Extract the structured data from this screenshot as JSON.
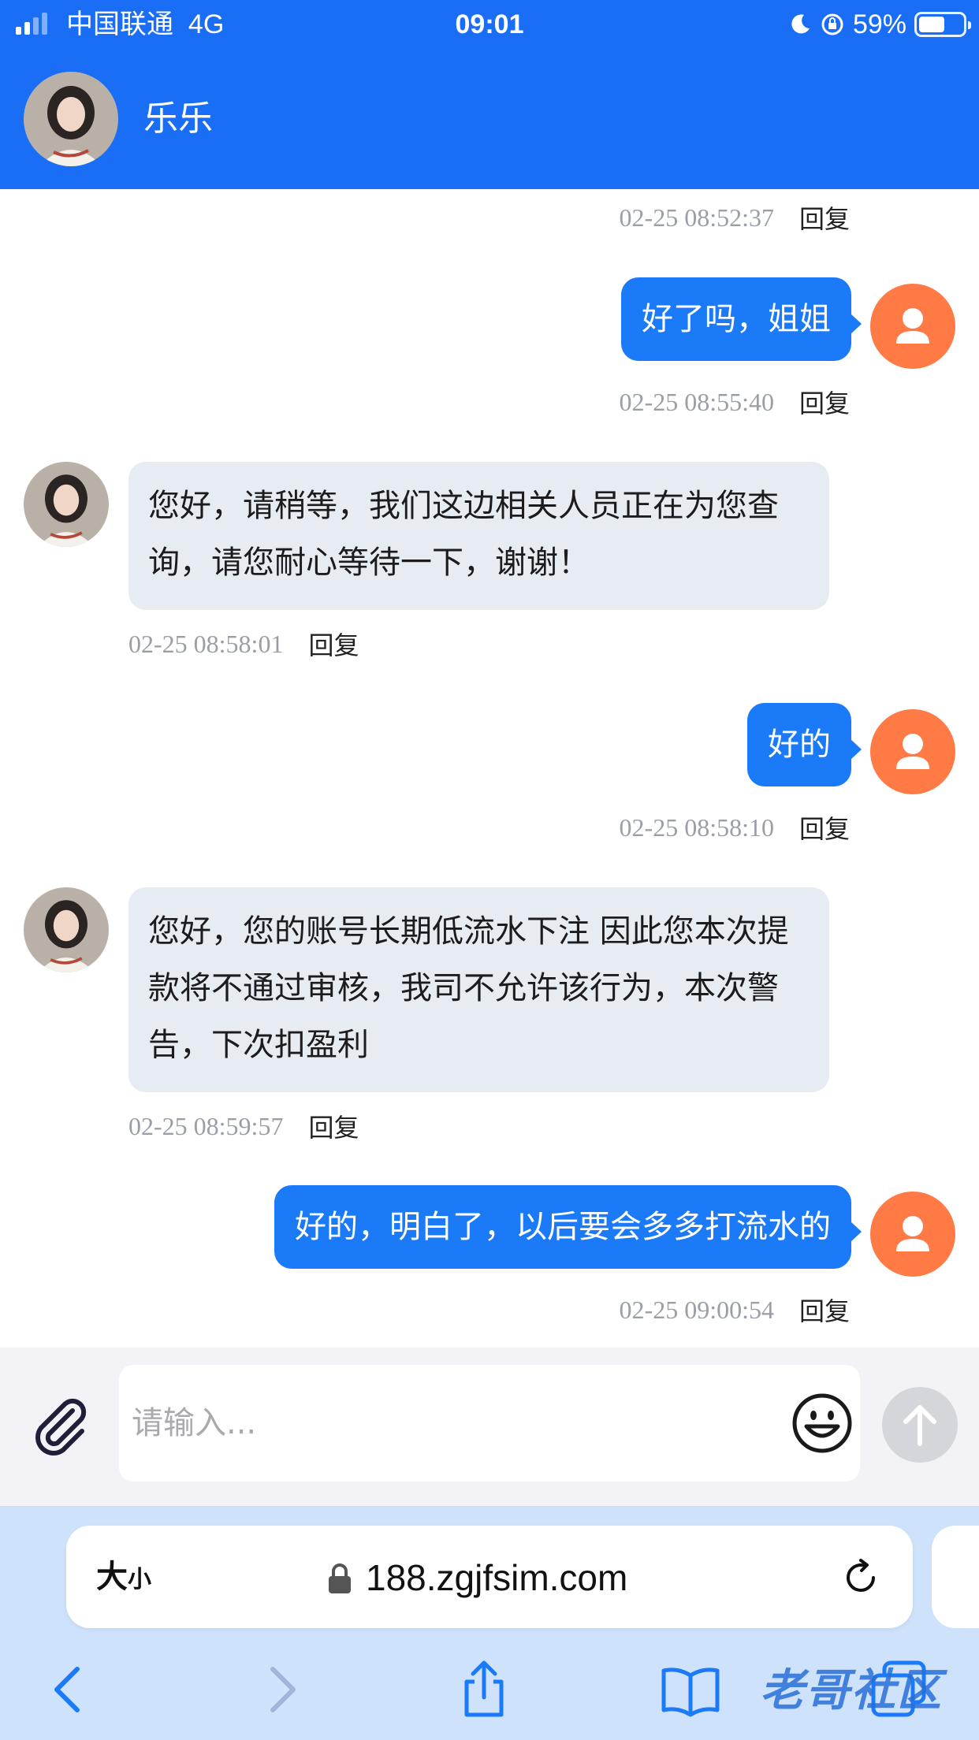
{
  "status_bar": {
    "carrier": "中国联通",
    "network": "4G",
    "time": "09:01",
    "battery_percent": "59%",
    "battery_level": 0.59
  },
  "header": {
    "contact_name": "乐乐"
  },
  "messages": [
    {
      "timestamp": "02-25 08:52:37",
      "reply": "回复"
    },
    {
      "text": "好了吗，姐姐",
      "timestamp": "02-25 08:55:40",
      "reply": "回复"
    },
    {
      "text": "您好，请稍等，我们这边相关人员正在为您查询，请您耐心等待一下，谢谢！",
      "timestamp": "02-25 08:58:01",
      "reply": "回复"
    },
    {
      "text": "好的",
      "timestamp": "02-25 08:58:10",
      "reply": "回复"
    },
    {
      "text": "您好，您的账号长期低流水下注 因此您本次提款将不通过审核，我司不允许该行为，本次警告，下次扣盈利",
      "timestamp": "02-25 08:59:57",
      "reply": "回复"
    },
    {
      "text": "好的，明白了，以后要会多多打流水的",
      "timestamp": "02-25 09:00:54",
      "reply": "回复"
    }
  ],
  "input": {
    "placeholder": "请输入..."
  },
  "browser": {
    "text_size_big": "大",
    "text_size_small": "小",
    "url": "188.zgjfsim.com"
  },
  "watermark": "老哥社区",
  "colors": {
    "brand_blue": "#1a6ef6",
    "outgoing_bubble": "#1a7af8",
    "incoming_bubble": "#e7ebf2",
    "user_avatar": "#ff7a45"
  }
}
